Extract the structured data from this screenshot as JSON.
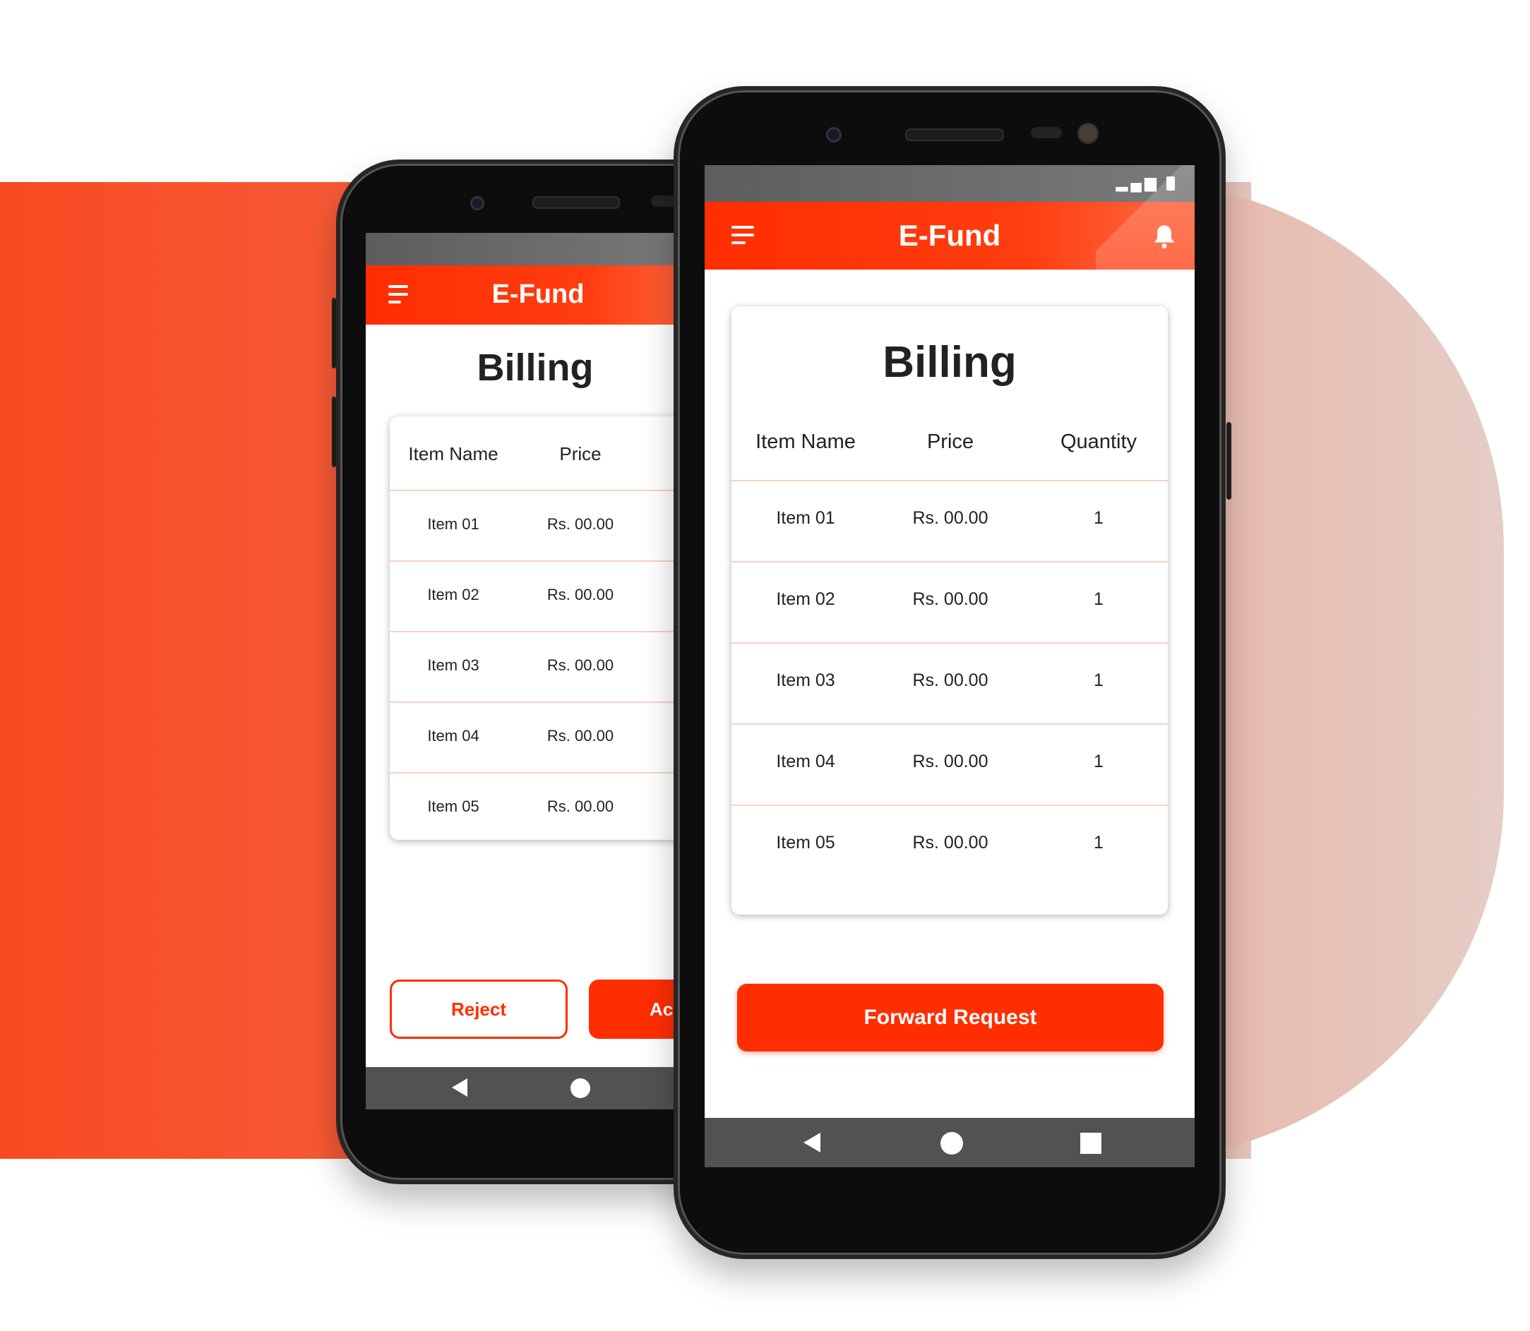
{
  "colors": {
    "brand_orange": "#ff2e00",
    "background_band": "#f84a22",
    "background_pill": "#e6c6bd",
    "row_divider": "#f6d2c4"
  },
  "back_phone": {
    "app_title": "E-Fund",
    "page_title": "Billing",
    "columns": [
      "Item Name",
      "Price"
    ],
    "rows": [
      {
        "name": "Item 01",
        "price": "Rs. 00.00"
      },
      {
        "name": "Item 02",
        "price": "Rs. 00.00"
      },
      {
        "name": "Item 03",
        "price": "Rs. 00.00"
      },
      {
        "name": "Item 04",
        "price": "Rs. 00.00"
      },
      {
        "name": "Item 05",
        "price": "Rs. 00.00"
      }
    ],
    "reject_label": "Reject",
    "accept_label_visible": "Acc",
    "icons": [
      "menu-icon",
      "nav-back-icon",
      "nav-home-icon"
    ]
  },
  "front_phone": {
    "app_title": "E-Fund",
    "page_title": "Billing",
    "columns": [
      "Item Name",
      "Price",
      "Quantity"
    ],
    "rows": [
      {
        "name": "Item 01",
        "price": "Rs. 00.00",
        "qty": "1"
      },
      {
        "name": "Item 02",
        "price": "Rs. 00.00",
        "qty": "1"
      },
      {
        "name": "Item 03",
        "price": "Rs. 00.00",
        "qty": "1"
      },
      {
        "name": "Item 04",
        "price": "Rs. 00.00",
        "qty": "1"
      },
      {
        "name": "Item 05",
        "price": "Rs. 00.00",
        "qty": "1"
      }
    ],
    "forward_label": "Forward Request",
    "icons": [
      "menu-icon",
      "bell-icon",
      "signal-icon",
      "battery-icon",
      "nav-back-icon",
      "nav-home-icon",
      "nav-recent-icon"
    ]
  }
}
